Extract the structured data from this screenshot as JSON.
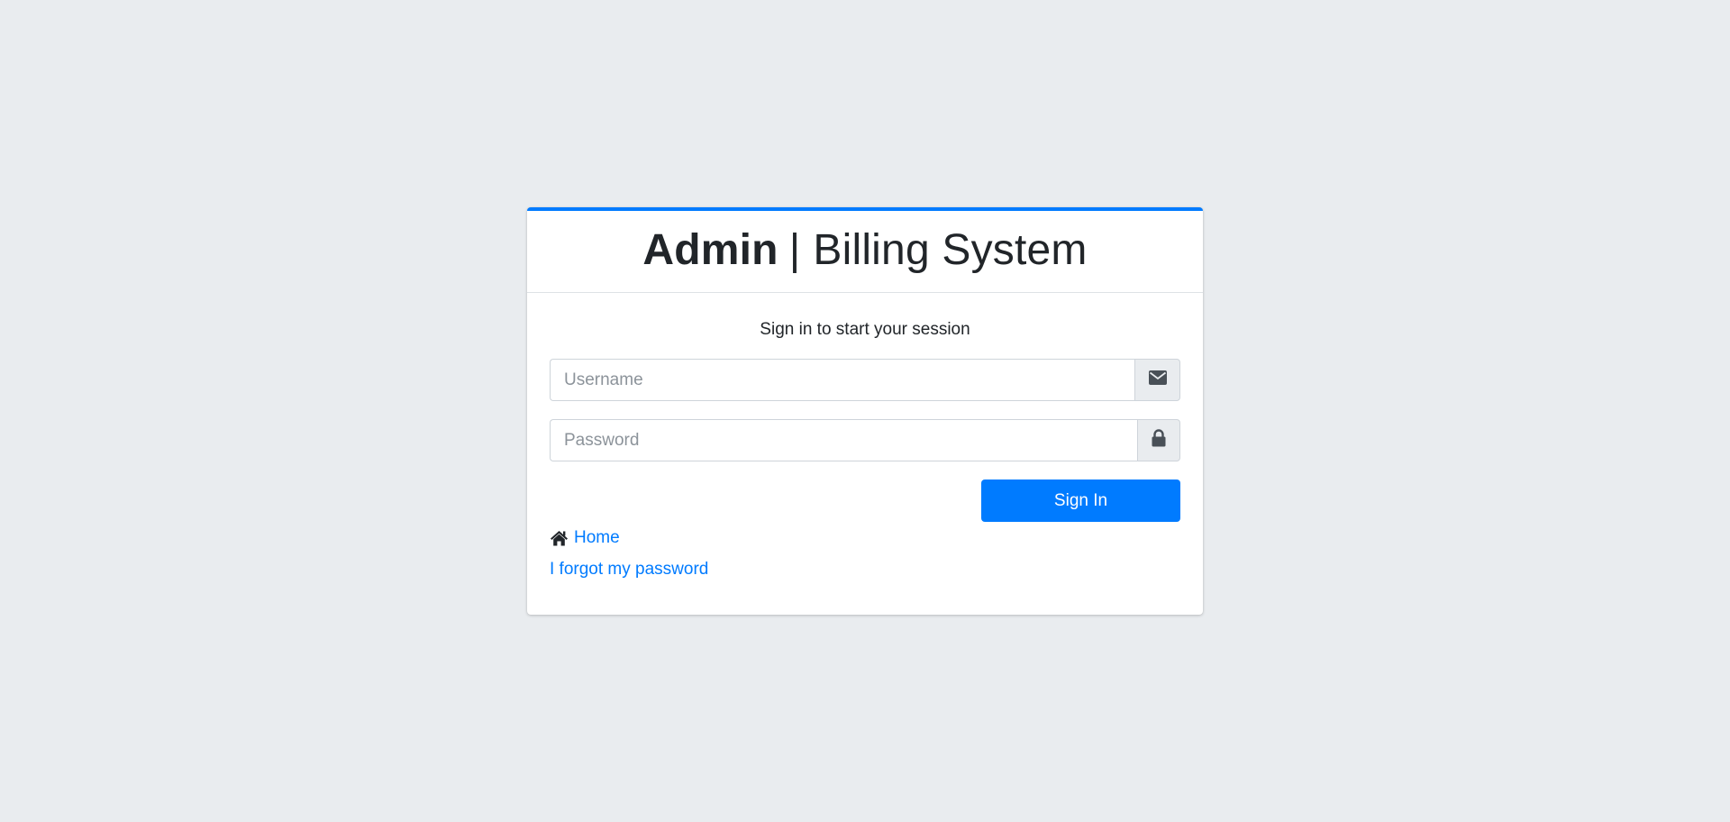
{
  "brand": {
    "strong": "Admin",
    "separator": "|",
    "light": "Billing System"
  },
  "login": {
    "message": "Sign in to start your session",
    "username": {
      "placeholder": "Username",
      "value": "",
      "icon": "envelope-icon"
    },
    "password": {
      "placeholder": "Password",
      "value": "",
      "icon": "lock-icon"
    },
    "submit_label": "Sign In"
  },
  "links": {
    "home_label": "Home",
    "home_icon": "home-icon",
    "forgot_label": "I forgot my password"
  },
  "colors": {
    "accent": "#007bff",
    "background": "#e9ecef",
    "text": "#212529"
  }
}
